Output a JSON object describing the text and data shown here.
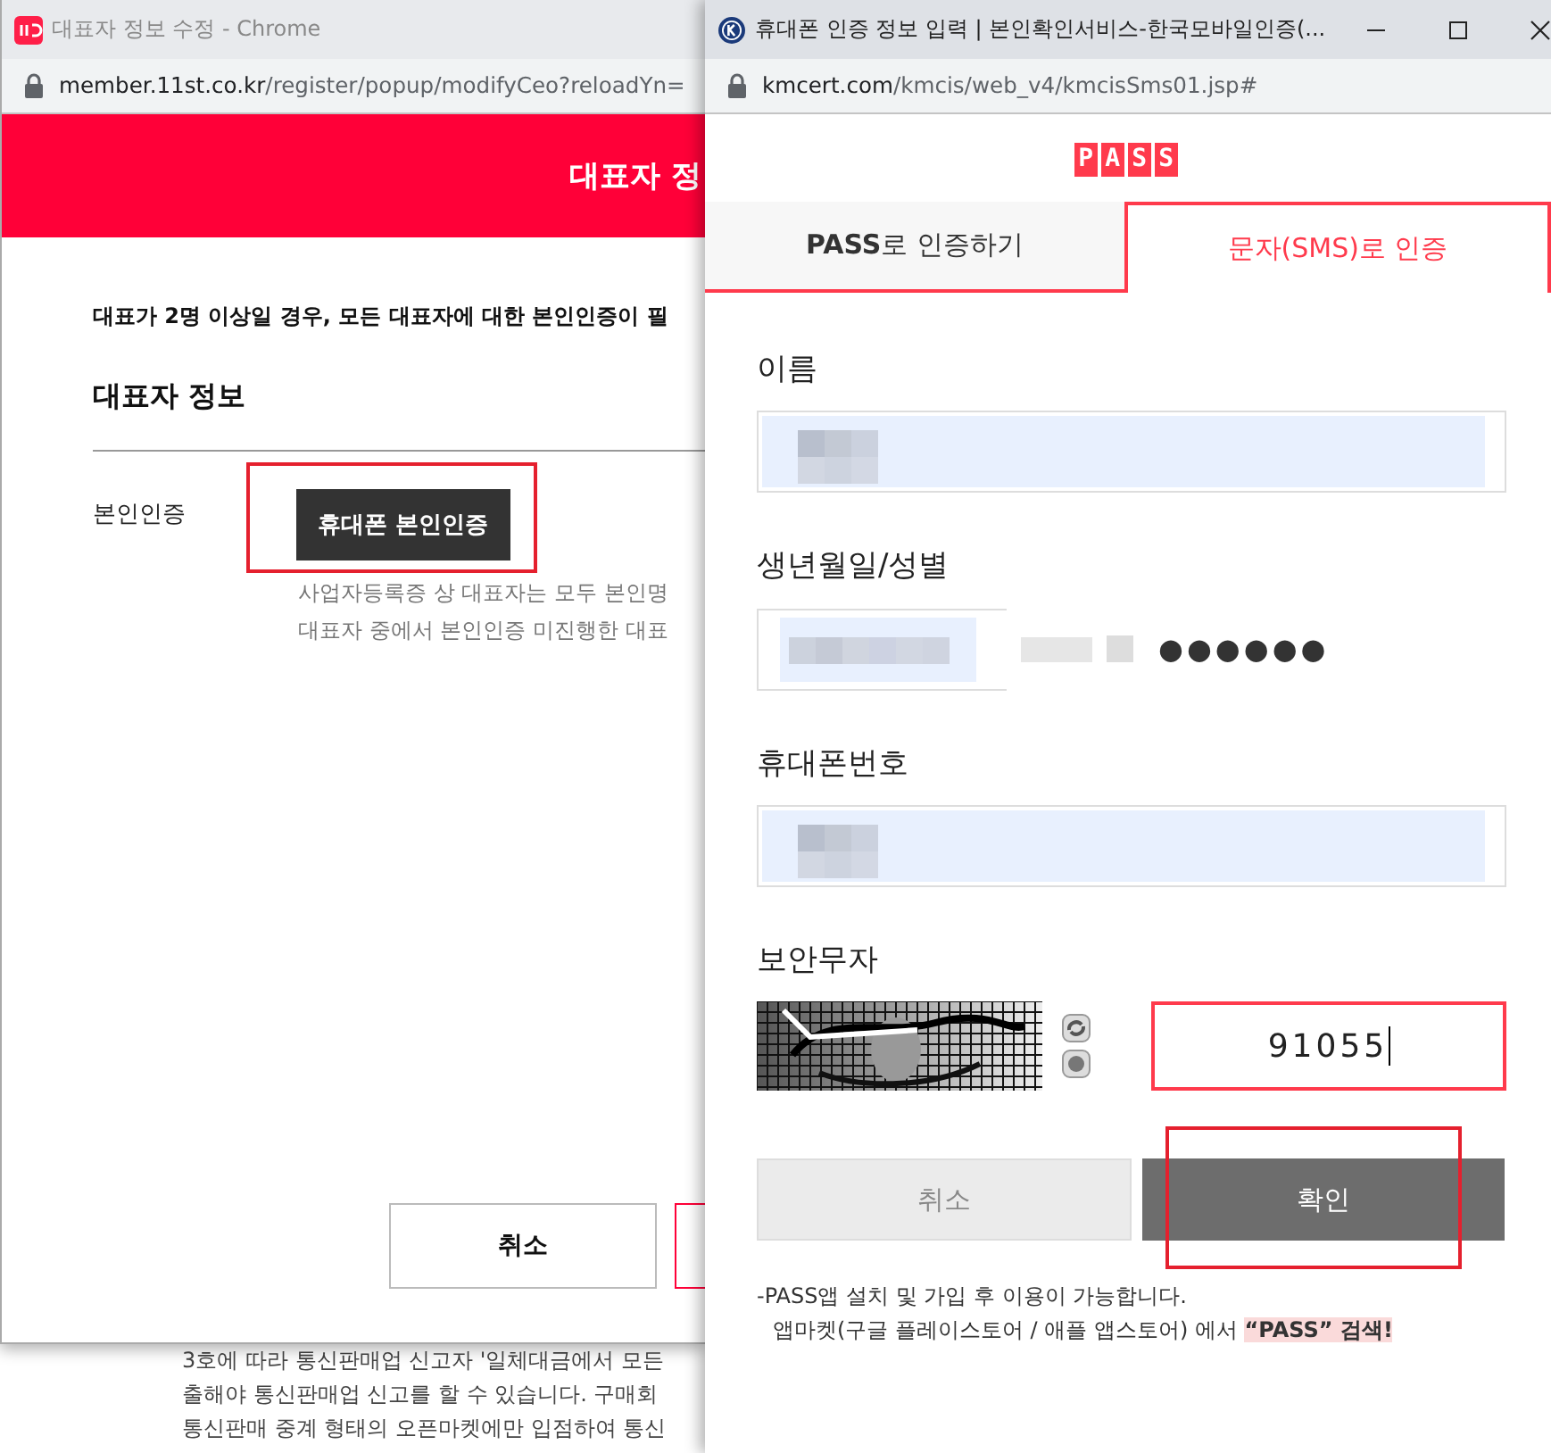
{
  "background_page": {
    "lines": [
      "3호에 따라 통신판매업 신고자 '일체대금에서 모든",
      "출해야 통신판매업 신고를 할 수 있습니다. 구매회",
      "통신판매 중계 형태의 오픈마켓에만 입점하여 통신"
    ]
  },
  "left_window": {
    "title": "대표자 정보 수정 - Chrome",
    "url_host": "member.11st.co.kr",
    "url_path": "/register/popup/modifyCeo?reloadYn=",
    "header": "대표자 정",
    "notice": "대표가 2명 이상일 경우, 모든 대표자에 대한 본인인증이 필",
    "section_title": "대표자 정보",
    "field_label": "본인인증",
    "verify_button": "휴대폰 본인인증",
    "hints": [
      "사업자등록증 상 대표자는 모두 본인명",
      "대표자 중에서 본인인증 미진행한 대표"
    ],
    "buttons": [
      {
        "kind": "secondary",
        "label": "취소"
      },
      {
        "kind": "primary"
      }
    ]
  },
  "right_window": {
    "title": "휴대폰 인증 정보 입력 | 본인확인서비스-한국모바일인증(...",
    "url_host": "kmcert.com",
    "url_path": "/kmcis/web_v4/kmcisSms01.jsp#",
    "logo": "PASS",
    "tabs": [
      {
        "label": "**PASS**로 인증하기",
        "selected": false
      },
      {
        "label": "문자(SMS)로 인증",
        "selected": true
      }
    ],
    "fields": [
      {
        "kind": "text",
        "label": "이름"
      },
      {
        "kind": "birth",
        "label": "생년월일/성별",
        "masked": "●●●●●●"
      },
      {
        "kind": "text",
        "label": "휴대폰번호"
      },
      {
        "kind": "captcha",
        "label": "보안무자",
        "value": "91055"
      }
    ],
    "buttons": [
      {
        "kind": "secondary",
        "label": "취소"
      },
      {
        "kind": "primary",
        "label": "확인"
      }
    ],
    "notes": [
      "-PASS앱 설치 및 가입 후 이용이 가능합니다.",
      "앱마켓(구글 플레이스토어 / 애플 앱스토어) 에서 **“PASS” 검색!**"
    ]
  }
}
